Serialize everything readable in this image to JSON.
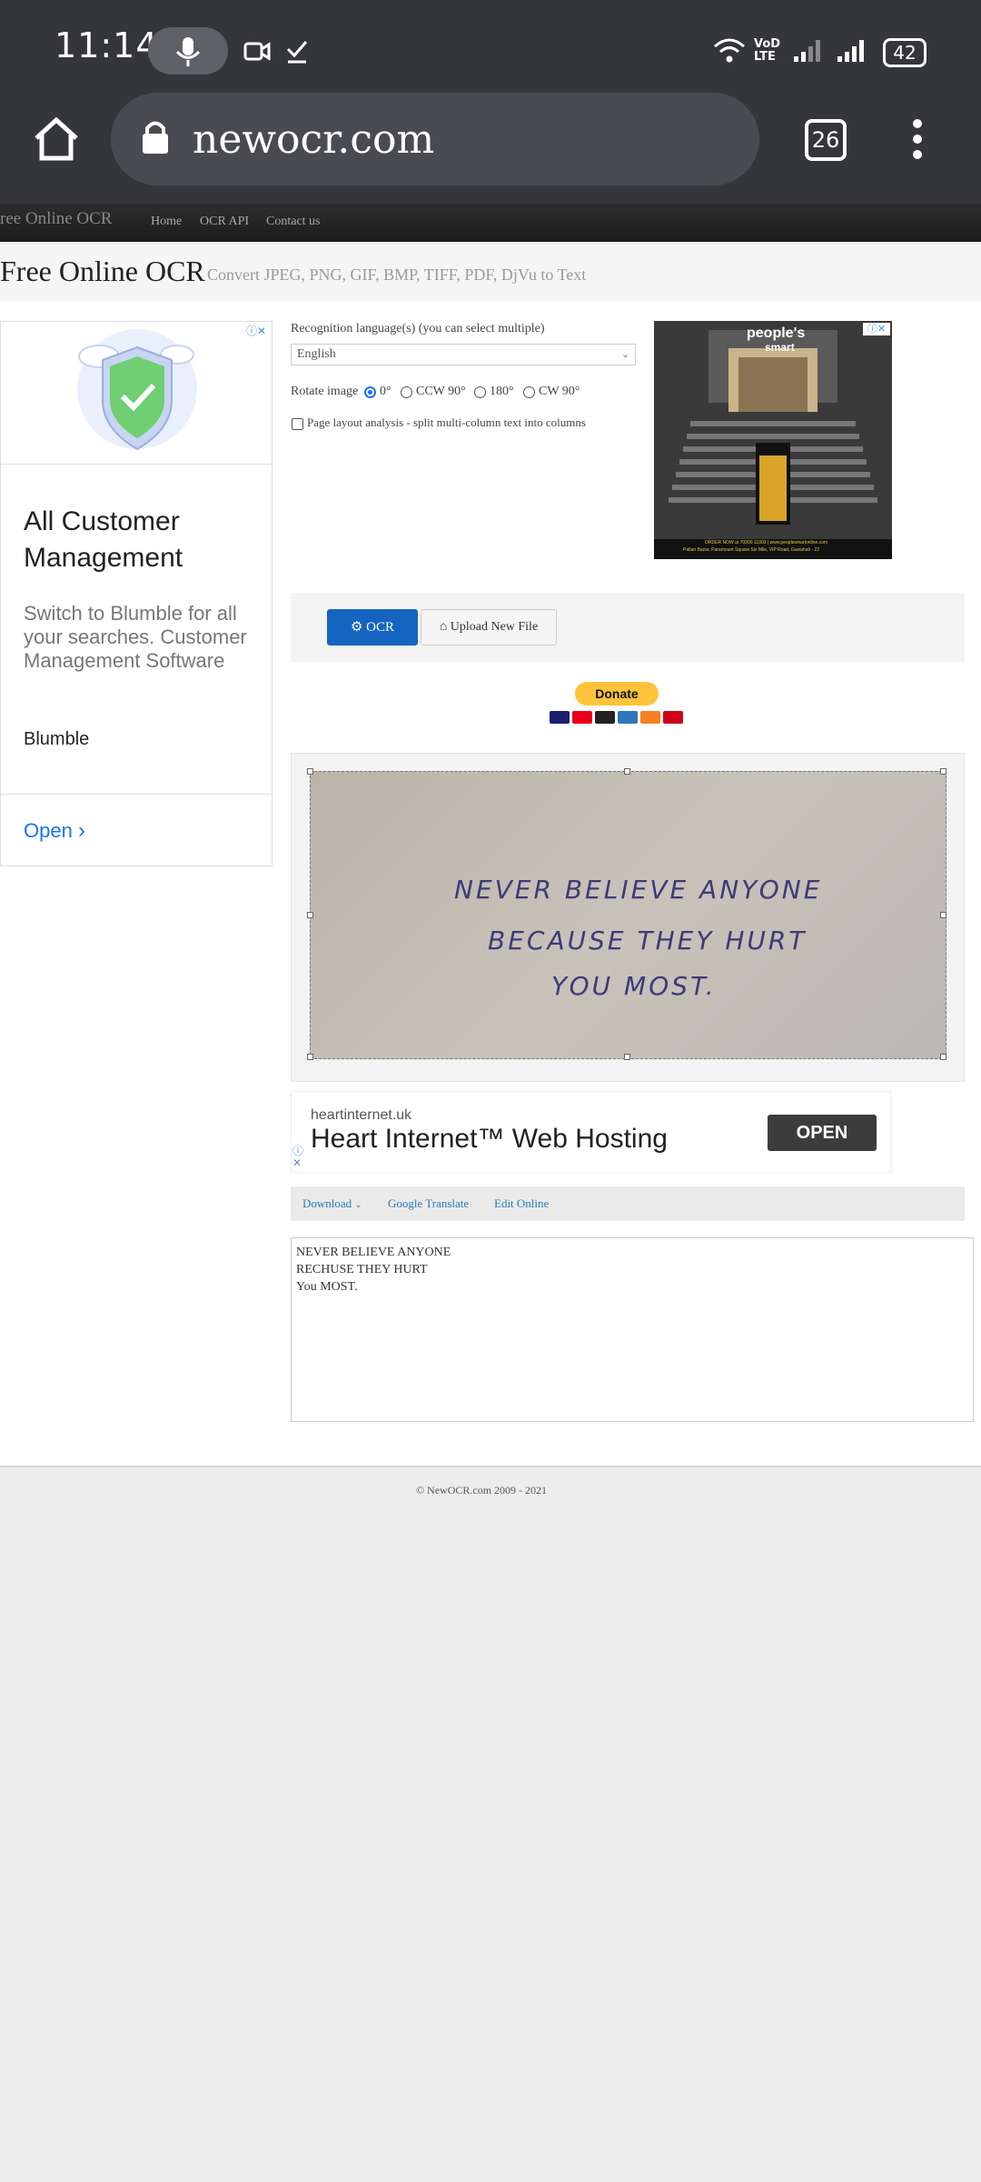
{
  "status_bar": {
    "time": "11:14",
    "network_label_1": "VoD",
    "network_label_2": "LTE",
    "battery": "42"
  },
  "browser": {
    "url": "newocr.com",
    "tab_count": "26"
  },
  "site_nav": {
    "brand": "ree Online OCR",
    "links": [
      "Home",
      "OCR API",
      "Contact us"
    ]
  },
  "header": {
    "title": "Free Online OCR",
    "subtitle": "Convert JPEG, PNG, GIF, BMP, TIFF, PDF, DjVu to Text"
  },
  "left_ad": {
    "title": "All Customer Management",
    "description": "Switch to Blumble for all your searches. Customer Management Software",
    "brand": "Blumble",
    "cta": "Open"
  },
  "form": {
    "language_label": "Recognition language(s) (you can select multiple)",
    "language_value": "English",
    "rotate_label": "Rotate image",
    "rotate_options": [
      "0°",
      "CCW 90°",
      "180°",
      "CW 90°"
    ],
    "rotate_selected": "0°",
    "layout_label": "Page layout analysis - split multi-column text into columns",
    "layout_checked": false
  },
  "right_ad": {
    "brand_line_1": "people's",
    "brand_line_2": "smart",
    "footer_text_1": "ORDER NOW at 70990 11003 | www.peoplesmartonline.com",
    "footer_text_2": "Paltan Bazar, Paramount Square Six Mile, VIP Road, Guwahati - 22"
  },
  "actions": {
    "ocr_label": "OCR",
    "upload_label": "Upload New File",
    "donate_label": "Donate"
  },
  "image_text": [
    "NEVER BELIEVE ANYONE",
    "BECAUSE THEY HURT",
    "YOU MOST."
  ],
  "heart_ad": {
    "domain": "heartinternet.uk",
    "title": "Heart Internet™ Web Hosting",
    "cta": "OPEN"
  },
  "result_toolbar": {
    "download": "Download",
    "translate": "Google Translate",
    "edit": "Edit Online"
  },
  "result_lines": [
    "NEVER BELIEVE ANYONE",
    "RECHUSE THEY HURT",
    "You MOST."
  ],
  "footer": "© NewOCR.com 2009 - 2021",
  "colors": {
    "chrome_bg": "#35363a",
    "ocr_button": "#1565c0",
    "donate": "#ffc439",
    "link": "#2a7ab9"
  }
}
